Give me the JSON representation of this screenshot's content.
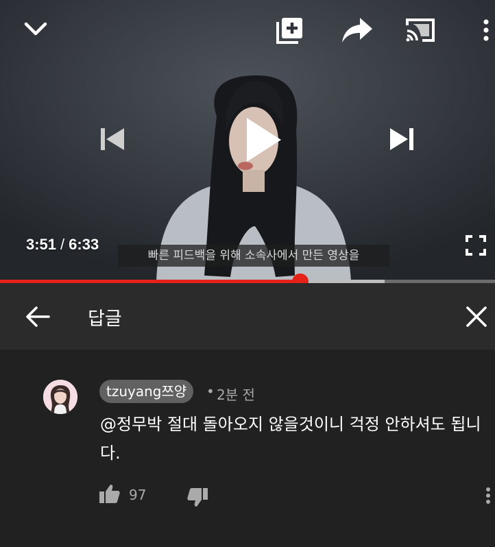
{
  "player": {
    "current_time": "3:51",
    "separator": "/",
    "duration": "6:33",
    "subtitle": "빠른 피드백을 위해 소속사에서 만든 영상을",
    "progress_played_fraction": 0.606,
    "progress_buffered_fraction": 0.777,
    "icons": {
      "collapse": "chevron-down-icon",
      "add_to_queue": "add-to-queue-icon",
      "share": "share-icon",
      "cast": "cast-icon",
      "more": "more-vert-icon",
      "previous": "skip-previous-icon",
      "play": "play-icon",
      "next": "skip-next-icon",
      "fullscreen": "fullscreen-icon"
    },
    "colors": {
      "progress_played": "#e62117"
    }
  },
  "replies_header": {
    "title": "답글",
    "back_icon": "arrow-back-icon",
    "close_icon": "close-icon"
  },
  "comment": {
    "author": "tzuyang쯔양",
    "dot": "•",
    "time": "2분 전",
    "text": "@정무박 절대 돌아오지 않을것이니 걱정 안하셔도 됩니다.",
    "likes": "97",
    "like_icon": "thumbs-up-icon",
    "dislike_icon": "thumbs-down-icon",
    "more_icon": "more-vert-icon"
  }
}
